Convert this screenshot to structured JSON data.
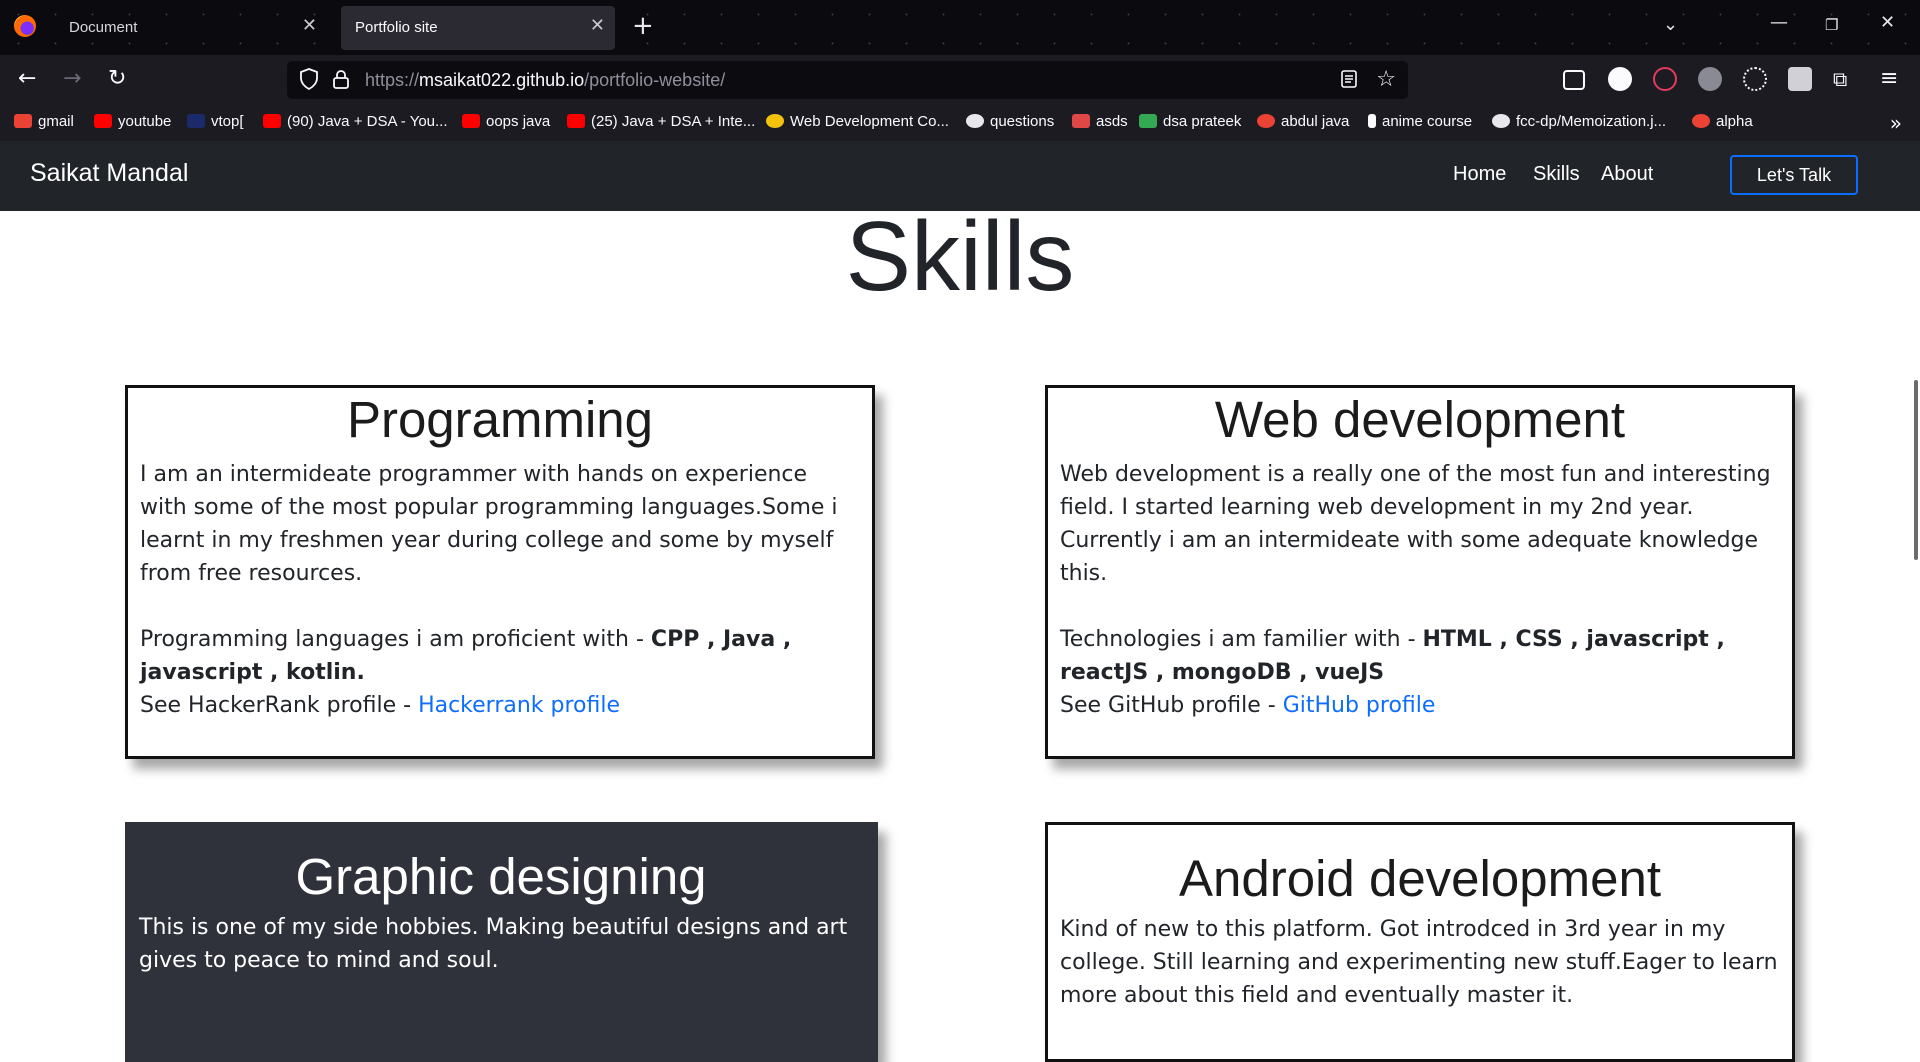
{
  "browser": {
    "tabs": [
      {
        "title": "Document",
        "active": false
      },
      {
        "title": "Portfolio site",
        "active": true
      }
    ],
    "url": {
      "scheme": "https://",
      "host": "msaikat022.github.io",
      "path": "/portfolio-website/"
    },
    "bookmarks": [
      {
        "label": "gmail",
        "icon": "gmail-icon",
        "color": "#ea4335"
      },
      {
        "label": "youtube",
        "icon": "youtube-icon",
        "color": "#ff0000"
      },
      {
        "label": "vtop[",
        "icon": "vtop-icon",
        "color": "#1b2a6b"
      },
      {
        "label": "(90) Java + DSA - You...",
        "icon": "youtube-icon",
        "color": "#ff0000"
      },
      {
        "label": "oops java",
        "icon": "youtube-icon",
        "color": "#ff0000"
      },
      {
        "label": "(25) Java + DSA + Inte...",
        "icon": "youtube-icon",
        "color": "#ff0000"
      },
      {
        "label": "Web Development Co...",
        "icon": "course-icon",
        "color": "#f4c20d"
      },
      {
        "label": "questions",
        "icon": "github-icon",
        "color": "#ffffff"
      },
      {
        "label": "asds",
        "icon": "flag-icon",
        "color": "#e04848"
      },
      {
        "label": "dsa prateek",
        "icon": "drive-icon",
        "color": "#34a853"
      },
      {
        "label": "abdul java",
        "icon": "gmail-icon",
        "color": "#ea4335"
      },
      {
        "label": "anime course",
        "icon": "bolt-icon",
        "color": "#ffffff"
      },
      {
        "label": "fcc-dp/Memoization.j...",
        "icon": "github-icon",
        "color": "#ffffff"
      },
      {
        "label": "alpha",
        "icon": "gmail-icon",
        "color": "#ea4335"
      }
    ]
  },
  "site": {
    "brand": "Saikat Mandal",
    "nav": [
      "Home",
      "Skills",
      "About"
    ],
    "cta": "Let's Talk",
    "section_title": "Skills",
    "cards": [
      {
        "title": "Programming",
        "intro": "I am an intermideate programmer with hands on experience with some of the most popular programming languages.Some i learnt in my freshmen year during college and some by myself from free resources.",
        "list_prefix": "Programming languages i am proficient with - ",
        "list_items": "CPP , Java , javascript , kotlin.",
        "profile_prefix": "See HackerRank profile - ",
        "profile_link": "Hackerrank profile"
      },
      {
        "title": "Web development",
        "intro": "Web development is a really one of the most fun and interesting field. I started learning web development in my 2nd year. Currently i am an intermideate with some adequate knowledge this.",
        "list_prefix": "Technologies i am familier with - ",
        "list_items": "HTML , CSS , javascript , reactJS , mongoDB , vueJS",
        "profile_prefix": "See GitHub profile - ",
        "profile_link": "GitHub profile"
      },
      {
        "title": "Graphic designing",
        "intro": "This is one of my side hobbies. Making beautiful designs and art gives to peace to mind and soul."
      },
      {
        "title": "Android development",
        "intro": "Kind of new to this platform. Got introdced in 3rd year in my college. Still learning and experimenting new stuff.Eager to learn more about this field and eventually master it."
      }
    ]
  },
  "colors": {
    "site_nav_bg": "#212529",
    "link": "#0d6efd",
    "dark_card": "#2f323a"
  }
}
